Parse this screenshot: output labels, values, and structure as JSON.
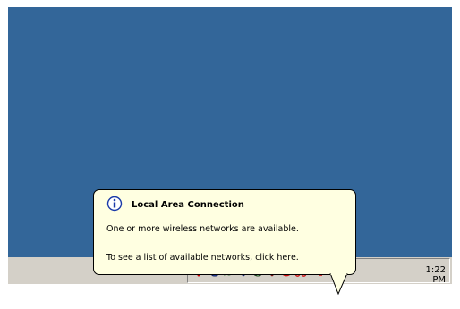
{
  "balloon": {
    "title": "Local Area Connection",
    "message": "One or more wireless networks are available.",
    "action": "To see a list of available networks, click here.",
    "icon": "info-icon"
  },
  "taskbar": {
    "clock": "1:22 PM",
    "tray_icons": [
      "magnifier-network-icon",
      "volume-icon",
      "sync-icon",
      "shield-icon",
      "network-globe-icon",
      "security-shield-icon",
      "blocked-icon",
      "scissors-icon",
      "network-connection-icon",
      "network-disconnected-icon"
    ]
  },
  "colors": {
    "desktop": "#336699",
    "taskbar": "#d4d0c8",
    "balloon": "#ffffe1"
  }
}
